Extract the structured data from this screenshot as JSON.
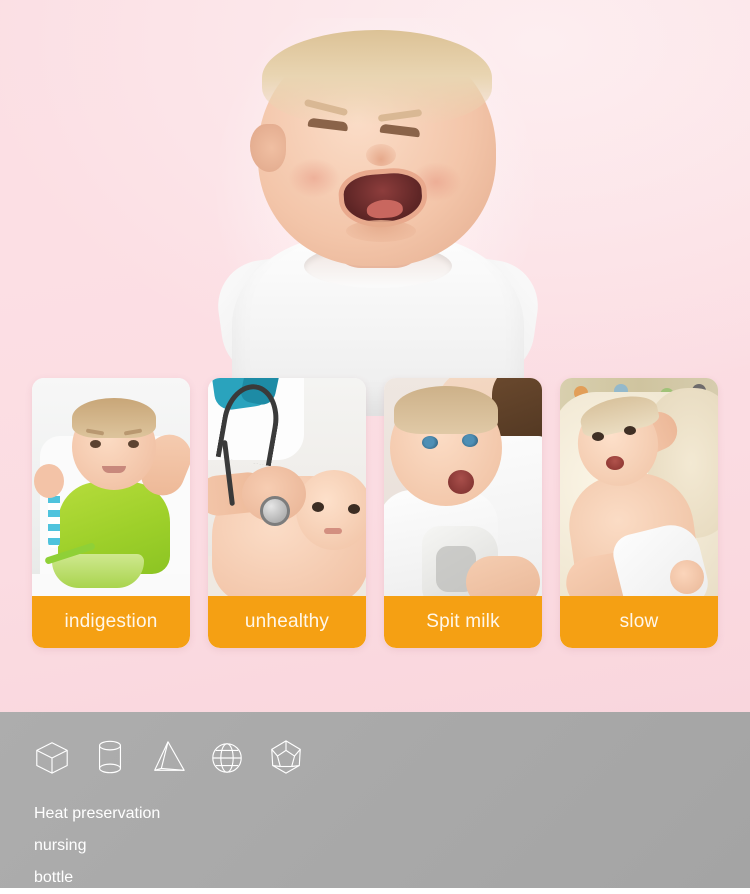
{
  "page": {
    "background_top_color": "#fbdfe4",
    "background_bottom_color": "#f9d6dd",
    "accent_orange": "#f5a013",
    "footer_gray": "#a9a9a9"
  },
  "hero": {
    "alt": "crying baby in white t-shirt"
  },
  "cards": [
    {
      "label": "indigestion",
      "photo_alt": "toddler in green bib refusing food bowl"
    },
    {
      "label": "unhealthy",
      "photo_alt": "doctor examining baby with stethoscope"
    },
    {
      "label": "Spit milk",
      "photo_alt": "baby spitting up held by mother with cloth"
    },
    {
      "label": "slow",
      "photo_alt": "baby in diaper lying on cream blanket"
    }
  ],
  "footer": {
    "icons": [
      "cube-icon",
      "cylinder-icon",
      "pyramid-icon",
      "sphere-icon",
      "dodecahedron-icon"
    ],
    "lines": [
      "Heat preservation",
      "nursing",
      "bottle"
    ]
  }
}
